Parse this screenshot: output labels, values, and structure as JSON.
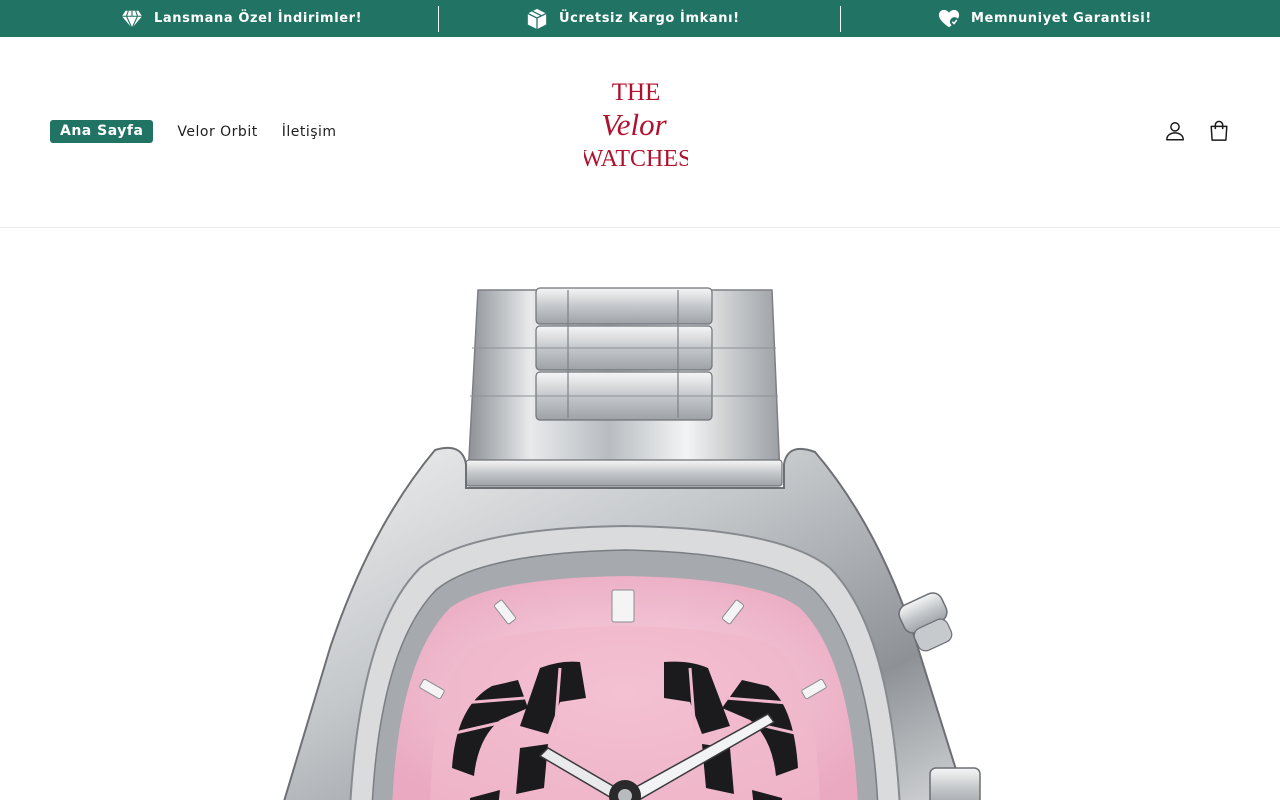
{
  "announcements": [
    {
      "text": "Lansmana Özel İndirimler!",
      "icon": "diamond-icon"
    },
    {
      "text": "Ücretsiz Kargo İmkanı!",
      "icon": "package-icon"
    },
    {
      "text": "Memnuniyet Garantisi!",
      "icon": "heart-check-icon"
    }
  ],
  "nav": {
    "items": [
      {
        "label": "Ana Sayfa",
        "active": true
      },
      {
        "label": "Velor Orbit",
        "active": false
      },
      {
        "label": "İletişim",
        "active": false
      }
    ]
  },
  "logo": {
    "line1": "THE",
    "line2": "Velor",
    "line3": "WATCHES"
  },
  "header_icons": [
    "account-icon",
    "cart-icon"
  ],
  "colors": {
    "brand": "#217364",
    "logo": "#b0122e",
    "dial": "#f2b9cc"
  }
}
